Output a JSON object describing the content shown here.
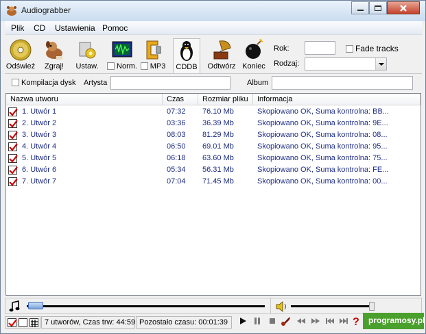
{
  "window": {
    "title": "Audiograbber"
  },
  "menu": [
    "Plik",
    "CD",
    "Ustawienia",
    "Pomoc"
  ],
  "toolbar": {
    "refresh": "Odśwież",
    "grab": "Zgraj!",
    "settings": "Ustaw.",
    "normalize": "Norm.",
    "mp3": "MP3",
    "cddb": "CDDB",
    "play": "Odtwórz",
    "exit": "Koniec",
    "year_label": "Rok:",
    "year_value": "",
    "genre_label": "Rodzaj:",
    "genre_value": "",
    "fade_tracks": "Fade tracks"
  },
  "album_bar": {
    "compilation": "Kompilacja dysk",
    "artist_label": "Artysta",
    "artist_value": "",
    "album_label": "Album",
    "album_value": ""
  },
  "table": {
    "headers": [
      "Nazwa utworu",
      "Czas",
      "Rozmiar pliku",
      "Informacja"
    ],
    "rows": [
      {
        "name": "1. Utwór  1",
        "time": "07:32",
        "size": "76.10 Mb",
        "info": "Skopiowano OK, Suma kontrolna: BB...",
        "checked": true
      },
      {
        "name": "2. Utwór  2",
        "time": "03:36",
        "size": "36.39 Mb",
        "info": "Skopiowano OK, Suma kontrolna: 9E...",
        "checked": true
      },
      {
        "name": "3. Utwór  3",
        "time": "08:03",
        "size": "81.29 Mb",
        "info": "Skopiowano OK, Suma kontrolna: 08...",
        "checked": true
      },
      {
        "name": "4. Utwór  4",
        "time": "06:50",
        "size": "69.01 Mb",
        "info": "Skopiowano OK, Suma kontrolna: 95...",
        "checked": true
      },
      {
        "name": "5. Utwór  5",
        "time": "06:18",
        "size": "63.60 Mb",
        "info": "Skopiowano OK, Suma kontrolna: 75...",
        "checked": true
      },
      {
        "name": "6. Utwór  6",
        "time": "05:34",
        "size": "56.31 Mb",
        "info": "Skopiowano OK, Suma kontrolna: FE...",
        "checked": true
      },
      {
        "name": "7. Utwór  7",
        "time": "07:04",
        "size": "71.45 Mb",
        "info": "Skopiowano OK, Suma kontrolna: 00...",
        "checked": true
      }
    ]
  },
  "status": {
    "tracks": "7 utworów, Czas trw: 44:59",
    "remaining": "Pozostało czasu: 00:01:39"
  },
  "watermark": "programosy.pl"
}
